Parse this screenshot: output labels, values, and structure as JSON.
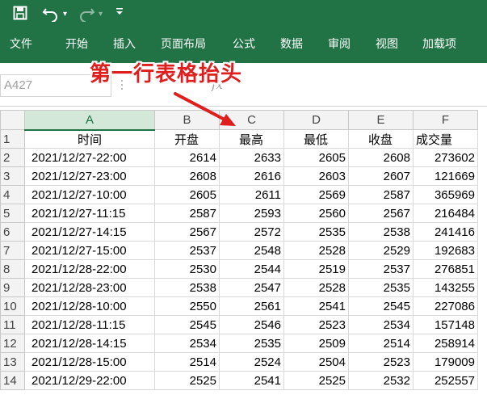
{
  "toolbar": {
    "save_icon": "save-icon",
    "undo_icon": "undo-icon",
    "redo_icon": "redo-icon",
    "customize_icon": "customize-icon"
  },
  "ribbon": {
    "tabs": [
      "文件",
      "开始",
      "插入",
      "页面布局",
      "公式",
      "数据",
      "审阅",
      "视图",
      "加载项"
    ]
  },
  "formula_bar": {
    "name_box": "A427",
    "fx_label": "fx"
  },
  "annotation": {
    "text": "第一行表格抬头"
  },
  "sheet": {
    "columns": [
      "A",
      "B",
      "C",
      "D",
      "E",
      "F"
    ],
    "header_row": [
      "时间",
      "开盘",
      "最高",
      "最低",
      "收盘",
      "成交量"
    ],
    "rows": [
      {
        "n": "1"
      },
      {
        "n": "2",
        "cells": [
          "2021/12/27-22:00",
          "2614",
          "2633",
          "2605",
          "2608",
          "273602"
        ]
      },
      {
        "n": "3",
        "cells": [
          "2021/12/27-23:00",
          "2608",
          "2616",
          "2603",
          "2607",
          "121669"
        ]
      },
      {
        "n": "4",
        "cells": [
          "2021/12/27-10:00",
          "2605",
          "2611",
          "2569",
          "2587",
          "365969"
        ]
      },
      {
        "n": "5",
        "cells": [
          "2021/12/27-11:15",
          "2587",
          "2593",
          "2560",
          "2567",
          "216484"
        ]
      },
      {
        "n": "6",
        "cells": [
          "2021/12/27-14:15",
          "2567",
          "2572",
          "2535",
          "2538",
          "241416"
        ]
      },
      {
        "n": "7",
        "cells": [
          "2021/12/27-15:00",
          "2537",
          "2548",
          "2528",
          "2529",
          "192683"
        ]
      },
      {
        "n": "8",
        "cells": [
          "2021/12/28-22:00",
          "2530",
          "2544",
          "2519",
          "2537",
          "276851"
        ]
      },
      {
        "n": "9",
        "cells": [
          "2021/12/28-23:00",
          "2538",
          "2547",
          "2528",
          "2535",
          "143255"
        ]
      },
      {
        "n": "10",
        "cells": [
          "2021/12/28-10:00",
          "2550",
          "2561",
          "2541",
          "2545",
          "227086"
        ]
      },
      {
        "n": "11",
        "cells": [
          "2021/12/28-11:15",
          "2545",
          "2546",
          "2523",
          "2534",
          "157148"
        ]
      },
      {
        "n": "12",
        "cells": [
          "2021/12/28-14:15",
          "2534",
          "2535",
          "2509",
          "2514",
          "258914"
        ]
      },
      {
        "n": "13",
        "cells": [
          "2021/12/28-15:00",
          "2514",
          "2524",
          "2504",
          "2523",
          "179009"
        ]
      },
      {
        "n": "14",
        "cells": [
          "2021/12/29-22:00",
          "2525",
          "2541",
          "2525",
          "2532",
          "252557"
        ]
      }
    ]
  },
  "colors": {
    "ribbon": "#217346",
    "annotation": "#e01e1e",
    "selected_header": "#d3e8d9"
  }
}
